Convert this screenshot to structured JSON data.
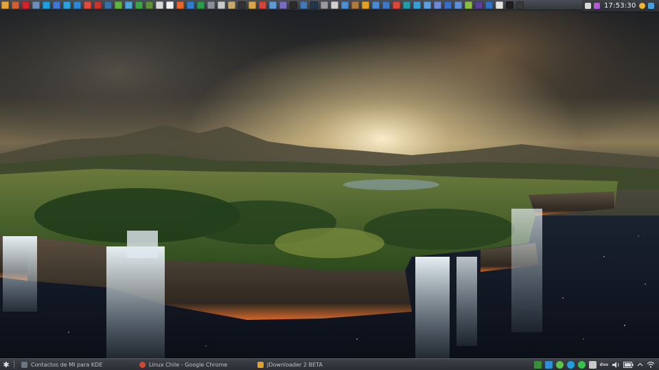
{
  "top_bar": {
    "launchers": [
      {
        "icon": "app-grid-icon",
        "color": "#e8a33a"
      },
      {
        "icon": "image-viewer-icon",
        "color": "#d0612e"
      },
      {
        "icon": "opera-icon",
        "color": "#d2232a"
      },
      {
        "icon": "network-icon",
        "color": "#6b8fb8"
      },
      {
        "icon": "skype-icon",
        "color": "#1e9fde"
      },
      {
        "icon": "vlc-icon",
        "color": "#3e7ad6"
      },
      {
        "icon": "telegram-icon",
        "color": "#2aa3dc"
      },
      {
        "icon": "dropbox-icon",
        "color": "#2d87d8"
      },
      {
        "icon": "share-icon",
        "color": "#e14b3b"
      },
      {
        "icon": "filezilla-icon",
        "color": "#c5352c"
      },
      {
        "icon": "terminal-icon",
        "color": "#3a6ea8"
      },
      {
        "icon": "settings-icon",
        "color": "#64b33d"
      },
      {
        "icon": "globe-icon",
        "color": "#4fa4d8"
      },
      {
        "icon": "download-icon",
        "color": "#3aa34a"
      },
      {
        "icon": "torrent-icon",
        "color": "#5b8f3a"
      },
      {
        "icon": "document-icon",
        "color": "#d9d9d9"
      },
      {
        "icon": "calendar-icon",
        "color": "#f2f2f2"
      },
      {
        "icon": "presentation-icon",
        "color": "#e7652a"
      },
      {
        "icon": "writer-icon",
        "color": "#2f7fd1"
      },
      {
        "icon": "spreadsheet-icon",
        "color": "#2d9c4a"
      },
      {
        "icon": "tools-icon",
        "color": "#8a8f96"
      },
      {
        "icon": "spreadsheet-alt-icon",
        "color": "#c9c9c9"
      },
      {
        "icon": "archive-icon",
        "color": "#c8a76a"
      },
      {
        "icon": "camera-icon",
        "color": "#333333"
      },
      {
        "icon": "folder-icon",
        "color": "#d8a648"
      },
      {
        "icon": "image-editor-icon",
        "color": "#d4443b"
      },
      {
        "icon": "photo-icon",
        "color": "#5c9bd6"
      },
      {
        "icon": "video-icon",
        "color": "#7a6cc1"
      },
      {
        "icon": "film-icon",
        "color": "#2b2b2b"
      },
      {
        "icon": "audio-icon",
        "color": "#4179b9"
      },
      {
        "icon": "monitor-icon",
        "color": "#24364d"
      },
      {
        "icon": "gear-icon",
        "color": "#9a9a9a"
      },
      {
        "icon": "disc-icon",
        "color": "#cfcfcf"
      },
      {
        "icon": "send-icon",
        "color": "#4c8fd8"
      },
      {
        "icon": "box-icon",
        "color": "#b07a3c"
      },
      {
        "icon": "picture-icon",
        "color": "#e3a21f"
      },
      {
        "icon": "map-icon",
        "color": "#4a8ad1"
      },
      {
        "icon": "chart-icon",
        "color": "#3f78c6"
      },
      {
        "icon": "chrome-icon",
        "color": "#e0463a"
      },
      {
        "icon": "arduino-icon",
        "color": "#1f9ea7"
      },
      {
        "icon": "store-icon",
        "color": "#3a9fd6"
      },
      {
        "icon": "photo-alt-icon",
        "color": "#5aa0e0"
      },
      {
        "icon": "cube-icon",
        "color": "#6d8ad9"
      },
      {
        "icon": "window-icon",
        "color": "#3a6fc9"
      },
      {
        "icon": "pencil-icon",
        "color": "#5f8fd6"
      },
      {
        "icon": "android-icon",
        "color": "#8ac042"
      },
      {
        "icon": "eclipse-icon",
        "color": "#5b3f9a"
      },
      {
        "icon": "search-icon",
        "color": "#2d72c2"
      },
      {
        "icon": "document-alt-icon",
        "color": "#e3e3e3"
      },
      {
        "icon": "console-icon",
        "color": "#1f1f1f"
      },
      {
        "icon": "terminal-alt-icon",
        "color": "#3a3a3a"
      }
    ],
    "clock_box": {
      "left_icon": {
        "icon": "calendar-small-icon",
        "color": "#d8d8d8"
      },
      "right_icon": {
        "icon": "notification-icon",
        "color": "#b35ad9"
      },
      "time": "17:53:30",
      "status_icon": {
        "icon": "weather-icon",
        "color": "#f0b52a"
      },
      "end_icon": {
        "icon": "panel-toggle-icon",
        "color": "#4a9fe0"
      }
    }
  },
  "taskbar": {
    "menu_icon": "kde-menu-icon",
    "tasks": [
      {
        "label": "Contactos de MI para KDE",
        "icon": "contacts-icon",
        "color": "#6d7680"
      },
      {
        "label": "Linux Chile - Google Chrome",
        "icon": "chrome-icon",
        "color": "#d3463a"
      },
      {
        "label": "JDownloader 2 BETA",
        "icon": "jdownloader-icon",
        "color": "#e0a12a"
      }
    ],
    "tray": [
      {
        "icon": "media-player-icon",
        "color": "#3c8f3a"
      },
      {
        "icon": "display-icon",
        "color": "#2d8fd8"
      },
      {
        "icon": "share-tray-icon",
        "color": "#5cc24a"
      },
      {
        "icon": "skype-tray-icon",
        "color": "#1fa0de"
      },
      {
        "icon": "status-online-icon",
        "color": "#36c24a"
      },
      {
        "icon": "clipboard-icon",
        "color": "#c9c9c9"
      }
    ],
    "keyboard_layout": "dvo",
    "volume_icon": "volume-icon",
    "battery_icon": "battery-icon",
    "expand_icon": "chevron-up-icon",
    "wifi_icon": "wifi-icon"
  }
}
